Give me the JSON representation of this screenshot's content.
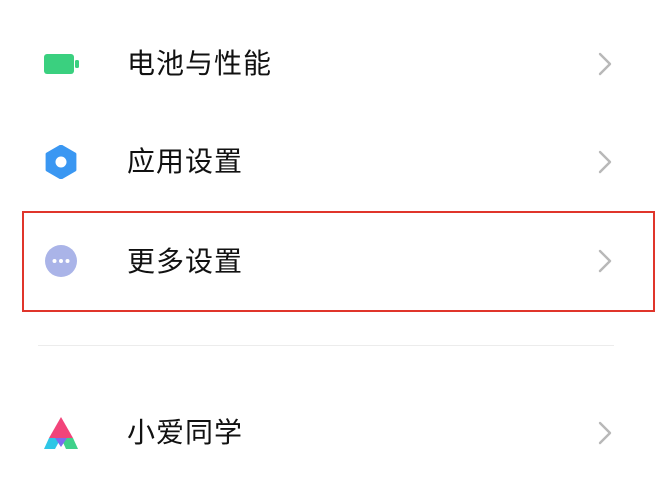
{
  "settings": {
    "items": [
      {
        "label": "电池与性能",
        "icon": "battery-icon"
      },
      {
        "label": "应用设置",
        "icon": "gear-icon"
      },
      {
        "label": "更多设置",
        "icon": "more-dots-icon"
      },
      {
        "label": "小爱同学",
        "icon": "xiaoai-logo-icon"
      }
    ]
  },
  "colors": {
    "battery_green": "#3ad07f",
    "gear_blue": "#3a97f2",
    "more_lavender": "#aab4e8",
    "highlight_red": "#e0352b",
    "chevron_gray": "#b8b8b8"
  }
}
